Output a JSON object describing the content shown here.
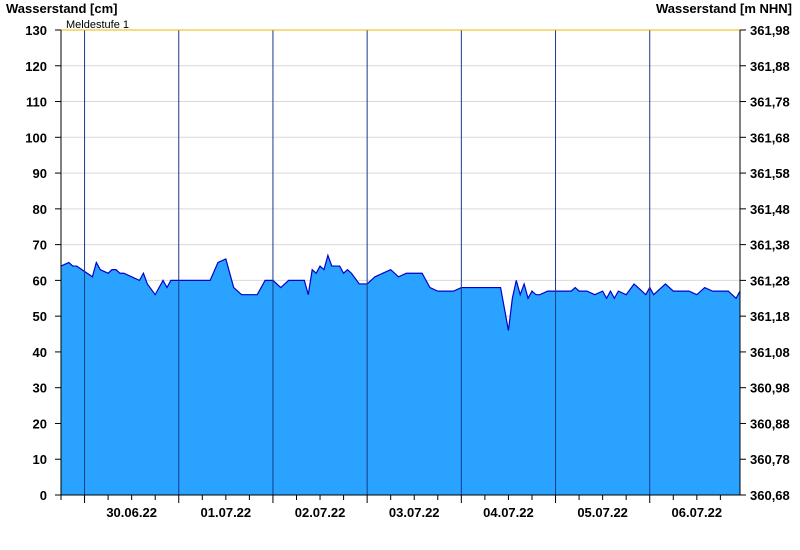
{
  "chart_data": {
    "type": "area",
    "ylabel_left": "Wasserstand [cm]",
    "ylabel_right": "Wasserstand [m NHN]",
    "ylim": [
      0,
      130
    ],
    "yticks_left": [
      0,
      10,
      20,
      30,
      40,
      50,
      60,
      70,
      80,
      90,
      100,
      110,
      120,
      130
    ],
    "yticks_right": [
      "360,68",
      "360,78",
      "360,88",
      "360,98",
      "361,08",
      "361,18",
      "361,28",
      "361,38",
      "361,48",
      "361,58",
      "361,68",
      "361,78",
      "361,88",
      "361,98"
    ],
    "x_start": "2022-06-29T18:00",
    "x_end": "2022-07-06T23:00",
    "x_day_boundaries": [
      "30.06.22",
      "01.07.22",
      "02.07.22",
      "03.07.22",
      "04.07.22",
      "05.07.22",
      "06.07.22"
    ],
    "xtick_labels": [
      "30.06.22",
      "01.07.22",
      "02.07.22",
      "03.07.22",
      "04.07.22",
      "05.07.22",
      "06.07.22"
    ],
    "threshold": {
      "label": "Meldestufe 1",
      "value": 130
    },
    "series": [
      {
        "color": "#29a3ff",
        "line_color": "#0000cc",
        "x_hours": [
          0,
          2,
          3,
          4,
          8,
          9,
          10,
          12,
          13,
          14,
          15,
          16,
          20,
          21,
          22,
          24,
          26,
          27,
          28,
          29,
          30,
          31,
          32,
          33,
          34,
          35,
          36,
          38,
          40,
          42,
          44,
          45,
          46,
          47,
          48,
          49,
          50,
          51,
          52,
          54,
          56,
          58,
          60,
          62,
          63,
          64,
          65,
          66,
          67,
          68,
          69,
          70,
          71,
          72,
          73,
          74,
          76,
          78,
          80,
          82,
          84,
          86,
          88,
          89,
          90,
          91,
          92,
          93,
          94,
          96,
          98,
          100,
          102,
          104,
          106,
          108,
          110,
          112,
          113,
          114,
          115,
          116,
          117,
          118,
          119,
          120,
          121,
          122,
          124,
          126,
          128,
          130,
          131,
          132,
          134,
          136,
          138,
          139,
          140,
          141,
          142,
          144,
          146,
          148,
          149,
          150,
          151,
          152,
          154,
          156,
          158,
          160,
          162,
          164,
          166,
          168,
          170,
          172,
          173
        ],
        "y": [
          64,
          65,
          64,
          64,
          61,
          65,
          63,
          62,
          63,
          63,
          62,
          62,
          60,
          62,
          59,
          56,
          60,
          58,
          60,
          60,
          60,
          60,
          60,
          60,
          60,
          60,
          60,
          60,
          65,
          66,
          58,
          57,
          56,
          56,
          56,
          56,
          56,
          58,
          60,
          60,
          58,
          60,
          60,
          60,
          56,
          63,
          62,
          64,
          63,
          67,
          64,
          64,
          64,
          62,
          63,
          62,
          59,
          59,
          61,
          62,
          63,
          61,
          62,
          62,
          62,
          62,
          62,
          60,
          58,
          57,
          57,
          57,
          58,
          58,
          58,
          58,
          58,
          58,
          52,
          46,
          55,
          60,
          56,
          59,
          55,
          57,
          56,
          56,
          57,
          57,
          57,
          57,
          58,
          57,
          57,
          56,
          57,
          55,
          57,
          55,
          57,
          56,
          59,
          57,
          56,
          58,
          56,
          57,
          59,
          57,
          57,
          57,
          56,
          58,
          57,
          57,
          57,
          55,
          57
        ]
      }
    ]
  }
}
